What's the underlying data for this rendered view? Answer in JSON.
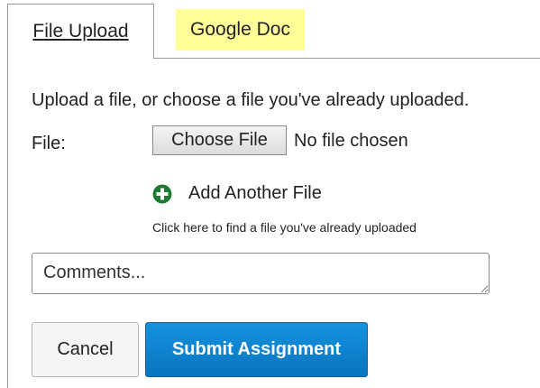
{
  "tabs": [
    {
      "label": "File Upload",
      "active": true
    },
    {
      "label": "Google Doc",
      "active": false,
      "highlight": "#ffff99"
    }
  ],
  "upload": {
    "intro": "Upload a file, or choose a file you've already uploaded.",
    "file_label": "File:",
    "choose_button": "Choose File",
    "no_file_text": "No file chosen",
    "add_another": "Add Another File",
    "find_uploaded": "Click here to find a file you've already uploaded",
    "add_icon": "plus-circle-icon",
    "add_icon_color": "#1f7a34"
  },
  "comments": {
    "placeholder": "Comments...",
    "value": ""
  },
  "actions": {
    "cancel": "Cancel",
    "submit": "Submit Assignment",
    "submit_color": "#0a74c0"
  }
}
